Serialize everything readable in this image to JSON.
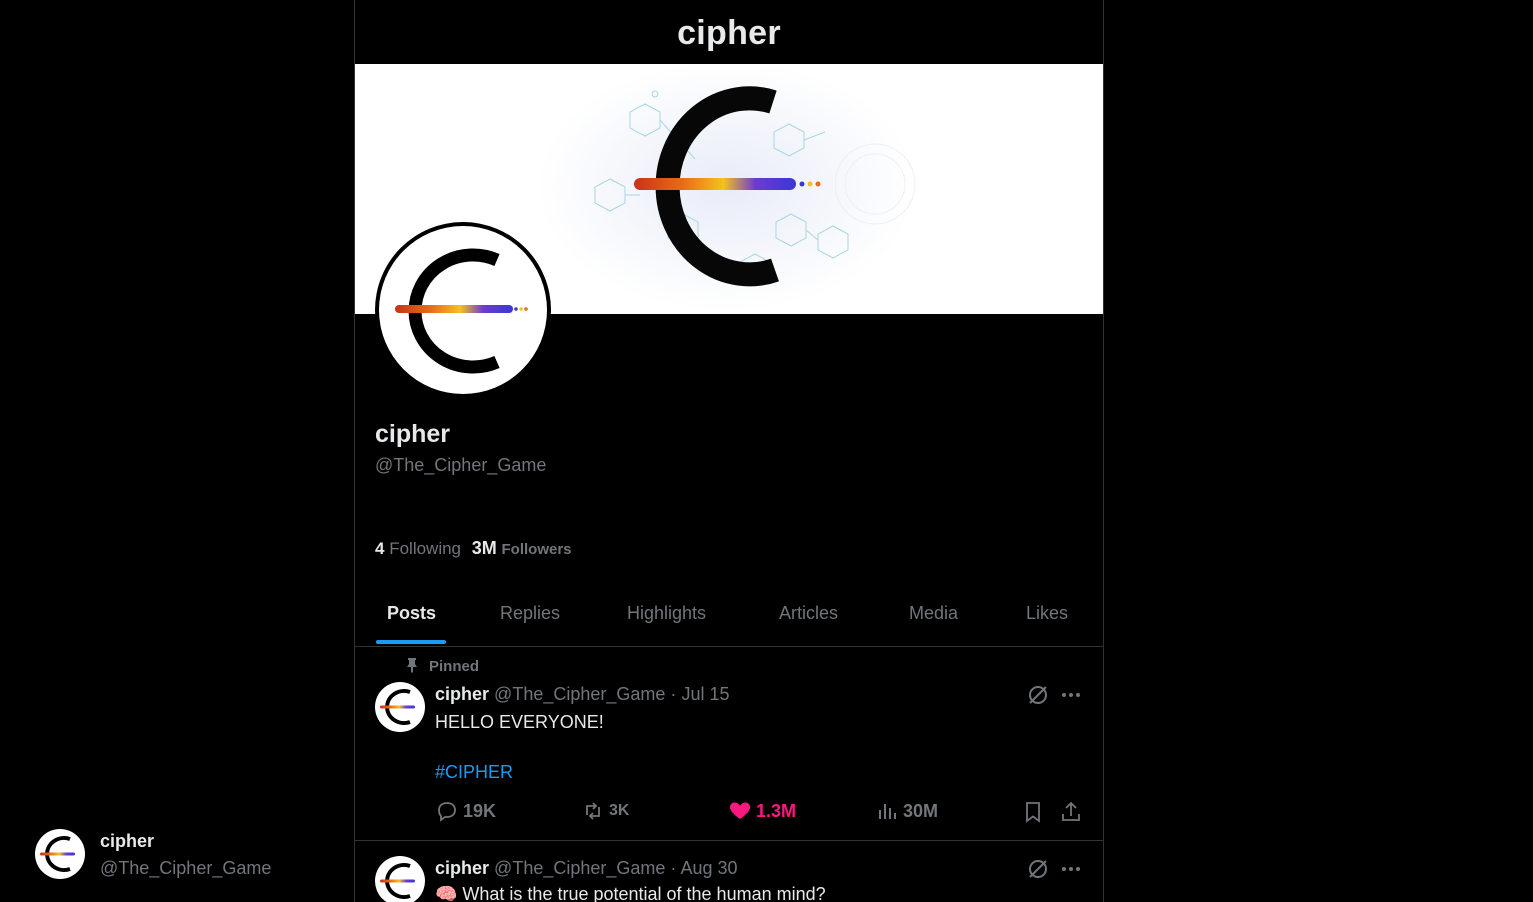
{
  "header": {
    "title": "cipher"
  },
  "profile": {
    "name": "cipher",
    "handle": "@The_Cipher_Game",
    "following_count": "4",
    "following_label": "Following",
    "followers_count": "3M",
    "followers_label": "Followers"
  },
  "tabs": [
    {
      "label": "Posts",
      "active": true
    },
    {
      "label": "Replies"
    },
    {
      "label": "Highlights"
    },
    {
      "label": "Articles"
    },
    {
      "label": "Media"
    },
    {
      "label": "Likes"
    }
  ],
  "posts": [
    {
      "pinned_label": "Pinned",
      "name": "cipher",
      "handle": "@The_Cipher_Game",
      "separator": "·",
      "date": "Jul 15",
      "text": "HELLO EVERYONE!",
      "hashtag": "#CIPHER",
      "replies": "19K",
      "reposts": "3K",
      "likes": "1.3M",
      "views": "30M"
    },
    {
      "name": "cipher",
      "handle": "@The_Cipher_Game",
      "separator": "·",
      "date": "Aug 30",
      "text": "🧠 What is the true potential of the human mind?"
    }
  ],
  "account_switcher": {
    "name": "cipher",
    "handle": "@The_Cipher_Game"
  },
  "colors": {
    "accent": "#1d9bf0",
    "like": "#f91880",
    "muted": "#71767b",
    "background": "#000000"
  },
  "icons": [
    "pin-icon",
    "grok-icon",
    "more-icon",
    "reply-icon",
    "repost-icon",
    "heart-icon",
    "views-icon",
    "bookmark-icon",
    "share-icon"
  ]
}
